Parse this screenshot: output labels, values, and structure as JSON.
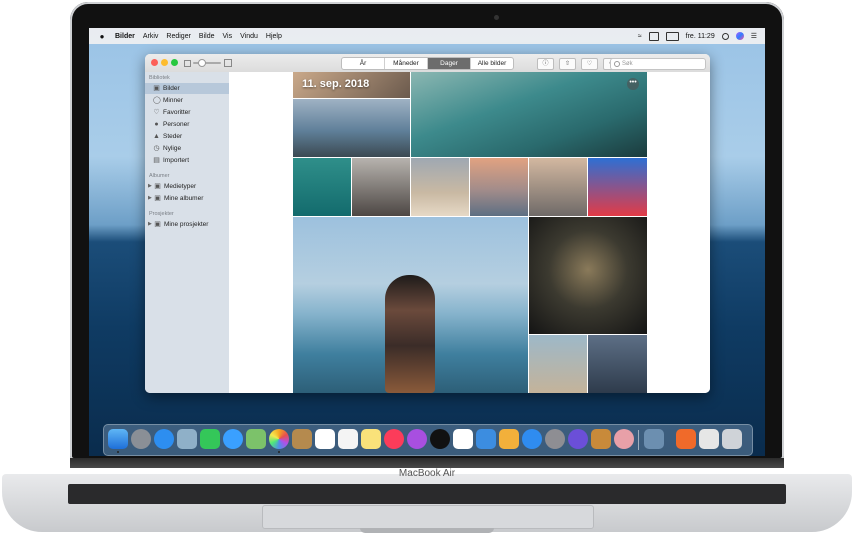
{
  "menubar": {
    "app_name": "Bilder",
    "items": [
      "Arkiv",
      "Rediger",
      "Bilde",
      "Vis",
      "Vindu",
      "Hjelp"
    ],
    "clock": "fre. 11:29"
  },
  "toolbar": {
    "tabs": [
      {
        "label": "År",
        "active": false
      },
      {
        "label": "Måneder",
        "active": false
      },
      {
        "label": "Dager",
        "active": true
      },
      {
        "label": "Alle bilder",
        "active": false
      }
    ],
    "search_placeholder": "Søk"
  },
  "sidebar": {
    "library_heading": "Bibliotek",
    "library_items": [
      {
        "label": "Bilder",
        "icon": "photos-icon",
        "selected": true
      },
      {
        "label": "Minner",
        "icon": "memories-icon",
        "selected": false
      },
      {
        "label": "Favoritter",
        "icon": "heart-icon",
        "selected": false
      },
      {
        "label": "Personer",
        "icon": "person-icon",
        "selected": false
      },
      {
        "label": "Steder",
        "icon": "pin-icon",
        "selected": false
      },
      {
        "label": "Nylige",
        "icon": "clock-icon",
        "selected": false
      },
      {
        "label": "Importert",
        "icon": "import-icon",
        "selected": false
      }
    ],
    "albums_heading": "Albumer",
    "album_items": [
      {
        "label": "Medietyper"
      },
      {
        "label": "Mine albumer"
      }
    ],
    "projects_heading": "Prosjekter",
    "project_items": [
      {
        "label": "Mine prosjekter"
      }
    ]
  },
  "content": {
    "date_heading": "11. sep. 2018",
    "more_label": "•••"
  },
  "laptop": {
    "model_label": "MacBook Air"
  },
  "colors": {
    "selection": "#b7c8da",
    "sidebar_bg": "#d9e0e8",
    "active_tab": "#6c6c6c"
  }
}
